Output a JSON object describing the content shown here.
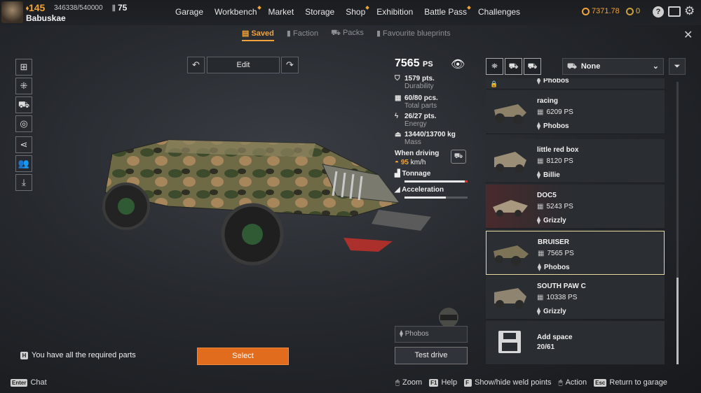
{
  "player": {
    "level": "145",
    "xp": "346338/540000",
    "rank": "75",
    "name": "Babuskae"
  },
  "nav": [
    "Garage",
    "Workbench",
    "Market",
    "Storage",
    "Shop",
    "Exhibition",
    "Battle Pass",
    "Challenges"
  ],
  "currency": {
    "coins": "7371.78",
    "other": "0"
  },
  "subtabs": [
    "Saved",
    "Faction",
    "Packs",
    "Favourite blueprints"
  ],
  "edit": {
    "label": "Edit"
  },
  "stats": {
    "ps": "7565",
    "ps_unit": "PS",
    "durability_val": "1579 pts.",
    "durability_label": "Durability",
    "parts_val": "60/80 pcs.",
    "parts_label": "Total parts",
    "energy_val": "26/27 pts.",
    "energy_label": "Energy",
    "mass_val": "13440/13700 kg",
    "mass_label": "Mass",
    "driving_label": "When driving",
    "speed": "95",
    "speed_unit": "km/h",
    "tonnage_label": "Tonnage",
    "tonnage_level": 0.97,
    "accel_label": "Acceleration",
    "accel_level": 0.66
  },
  "filter": {
    "selected": "None"
  },
  "list": [
    {
      "name": "",
      "ps": "",
      "faction": "Phobos"
    },
    {
      "name": "racing",
      "ps": "6209 PS",
      "faction": "Phobos"
    },
    {
      "name": "little red box",
      "ps": "8120 PS",
      "faction": "Billie"
    },
    {
      "name": "DOC5",
      "ps": "5243 PS",
      "faction": "Grizzly"
    },
    {
      "name": "BRUISER",
      "ps": "7565 PS",
      "faction": "Phobos"
    },
    {
      "name": "SOUTH PAW C",
      "ps": "10338 PS",
      "faction": "Grizzly"
    }
  ],
  "add_space": {
    "label": "Add space",
    "count": "20/61"
  },
  "bottom": {
    "driver_faction": "Phobos",
    "test_drive": "Test drive",
    "select": "Select",
    "required": "You have all the required parts",
    "required_key": "H",
    "chat": "Chat",
    "chat_key": "Enter"
  },
  "hints": [
    {
      "key": "",
      "label": "Zoom"
    },
    {
      "key": "F1",
      "label": "Help"
    },
    {
      "key": "F",
      "label": "Show/hide weld points"
    },
    {
      "key": "",
      "label": "Action"
    },
    {
      "key": "Esc",
      "label": "Return to garage"
    }
  ],
  "colors": {
    "accent": "#f0a33a",
    "select_button": "#e26c1e",
    "selected_border": "#e9dca0"
  }
}
